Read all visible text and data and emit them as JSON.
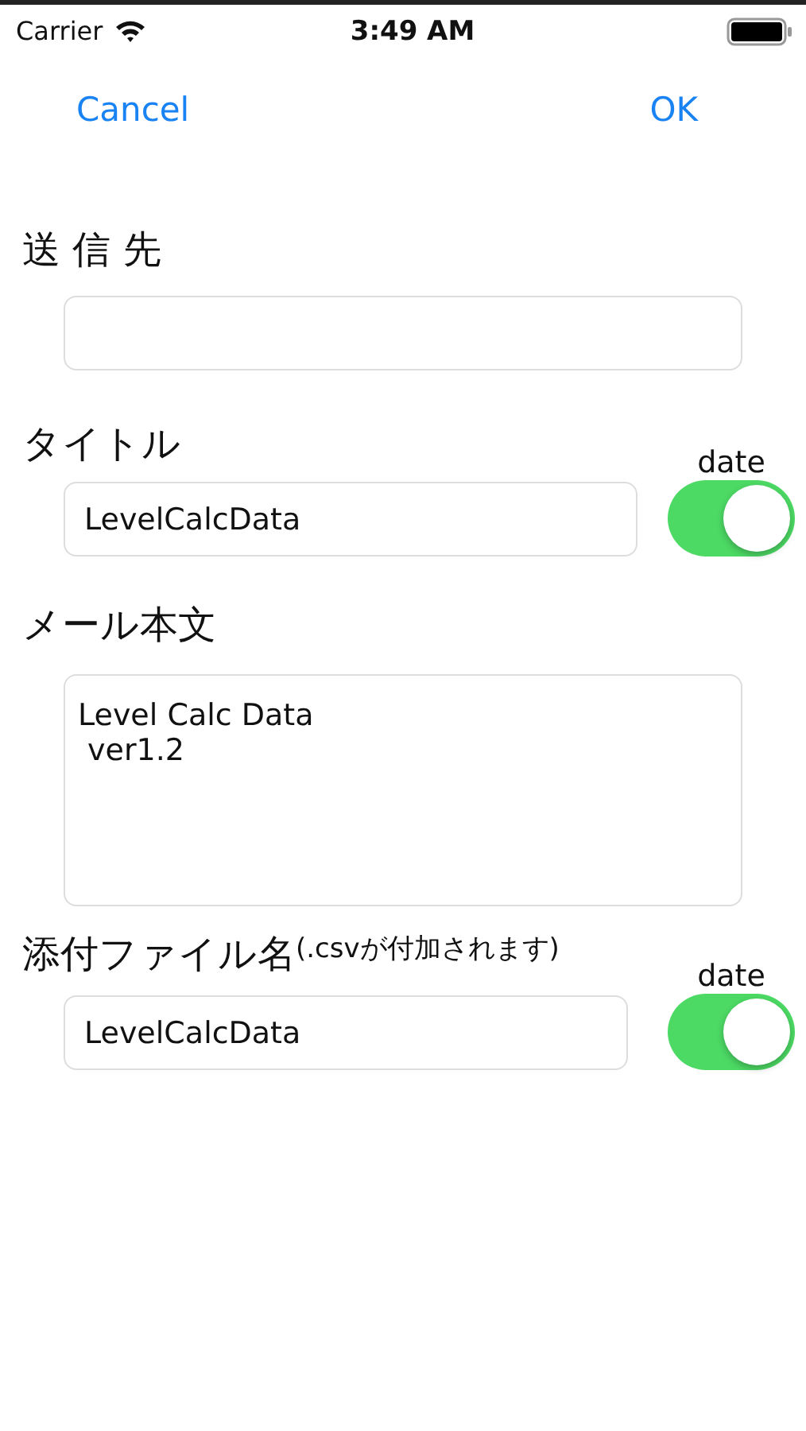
{
  "status_bar": {
    "carrier": "Carrier",
    "time": "3:49 AM"
  },
  "nav": {
    "left": "Cancel",
    "right": "OK"
  },
  "sections": [
    {
      "kind": "field",
      "label": "送 信 先"
    },
    {
      "kind": "field_toggle",
      "label": "タイトル",
      "value": "LevelCalcData",
      "toggle_label": "date",
      "on": true
    },
    {
      "kind": "textarea",
      "label": "メール本文",
      "value": "Level Calc Data\n ver1.2"
    },
    {
      "kind": "field_toggle",
      "label": "添付ファイル名",
      "note": "(.csvが付加されます)",
      "value": "LevelCalcData",
      "toggle_label": "date",
      "on": true
    }
  ]
}
